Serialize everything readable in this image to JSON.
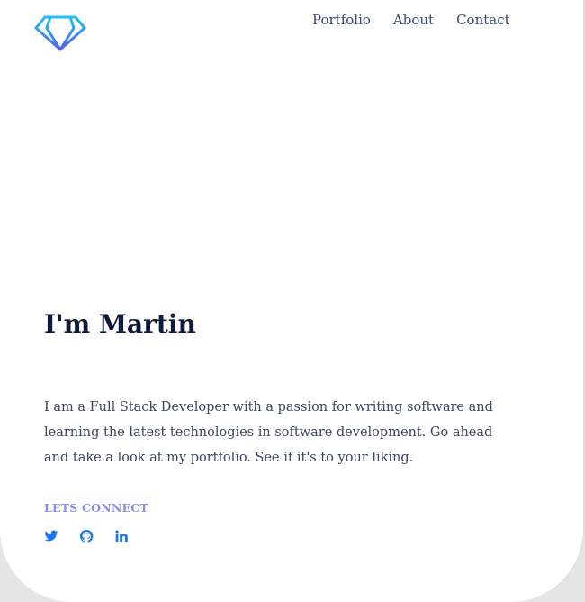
{
  "nav": {
    "items": [
      {
        "label": "Portfolio"
      },
      {
        "label": "About"
      },
      {
        "label": "Contact"
      }
    ]
  },
  "hero": {
    "title": "I'm Martin",
    "bio": "I am a Full Stack Developer with a passion for writing software and learning the latest technologies in software development. Go ahead and take a look at my portfolio. See if it's to your liking."
  },
  "connect": {
    "heading": "LETS CONNECT",
    "socials": [
      {
        "icon": "twitter-icon"
      },
      {
        "icon": "github-icon"
      },
      {
        "icon": "linkedin-icon"
      }
    ]
  },
  "colors": {
    "accent": "#1877f2",
    "logo_gradient_top": "#22c1e8",
    "logo_gradient_bottom": "#5561f2",
    "connect_heading": "#8b8bf2",
    "title": "#0f1b3d",
    "background": "#e5e5e5"
  }
}
